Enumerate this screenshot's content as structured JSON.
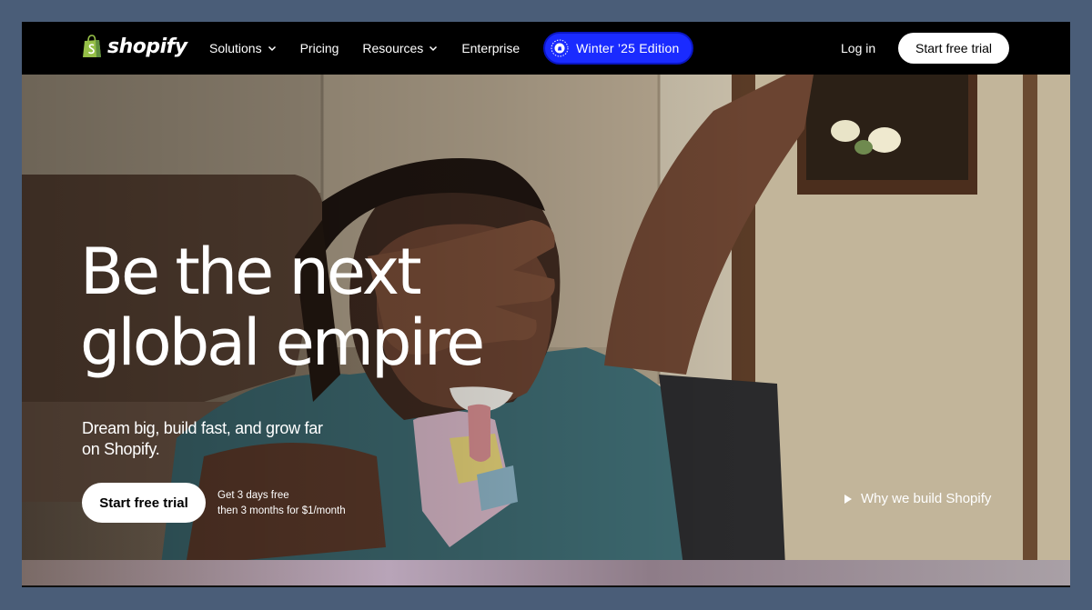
{
  "brand": {
    "name": "shopify",
    "color": "#95BF47"
  },
  "nav": {
    "items": [
      {
        "label": "Solutions",
        "has_dropdown": true
      },
      {
        "label": "Pricing",
        "has_dropdown": false
      },
      {
        "label": "Resources",
        "has_dropdown": true
      },
      {
        "label": "Enterprise",
        "has_dropdown": false
      }
    ],
    "edition": {
      "label": "Winter ’25 Edition",
      "color": "#1A2BFF"
    },
    "login": "Log in",
    "cta": "Start free trial"
  },
  "hero": {
    "headline_line1": "Be the next",
    "headline_line2": "global empire",
    "subheadline": "Dream big, build fast, and grow far on Shopify.",
    "cta": "Start free trial",
    "offer_line1": "Get 3 days free",
    "offer_line2": "then 3 months for $1/month",
    "video_link": "Why we build Shopify"
  },
  "icons": {
    "logo": "shopify-bag-icon",
    "dropdown": "chevron-down-icon",
    "edition": "edition-badge-icon",
    "play": "play-icon"
  }
}
